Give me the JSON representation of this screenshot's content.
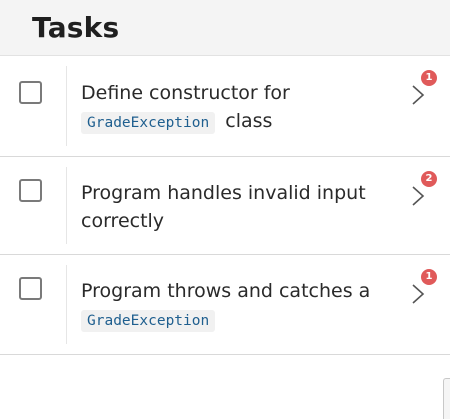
{
  "header": {
    "title": "Tasks"
  },
  "tasks": [
    {
      "text_before": "Define constructor for",
      "code": "GradeException",
      "text_after": "class",
      "badge": "1"
    },
    {
      "text_before": "Program handles invalid input correctly",
      "code": "",
      "text_after": "",
      "badge": "2"
    },
    {
      "text_before": "Program throws and catches a",
      "code": "GradeException",
      "text_after": "",
      "badge": "1"
    }
  ],
  "colors": {
    "badge": "#e05a5a",
    "code_text": "#1f5f8f",
    "header_bg": "#f4f4f4"
  },
  "icons": {
    "chevron": "chevron-right-icon",
    "checkbox": "checkbox-unchecked"
  }
}
